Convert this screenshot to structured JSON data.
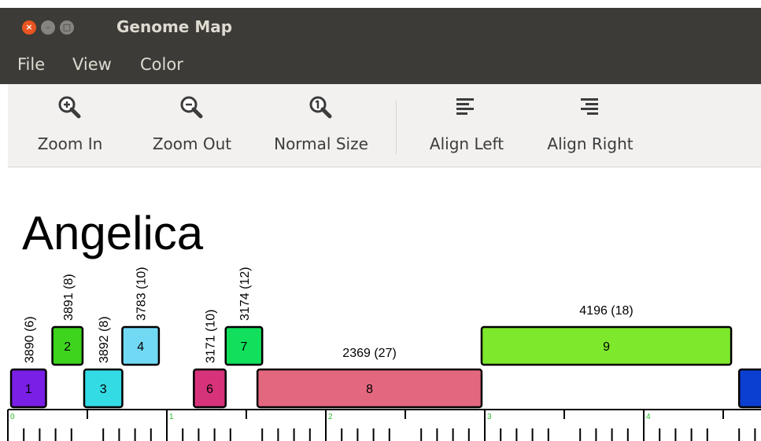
{
  "window": {
    "title": "Genome Map",
    "close_glyph": "×"
  },
  "menu": {
    "items": [
      "File",
      "View",
      "Color"
    ]
  },
  "toolbar": {
    "zoom_in": {
      "label": "Zoom In",
      "icon": "zoom-in-icon"
    },
    "zoom_out": {
      "label": "Zoom Out",
      "icon": "zoom-out-icon"
    },
    "normal_size": {
      "label": "Normal Size",
      "icon": "zoom-normal-icon"
    },
    "align_left": {
      "label": "Align Left",
      "icon": "align-left-icon"
    },
    "align_right": {
      "label": "Align Right",
      "icon": "align-right-icon"
    }
  },
  "map": {
    "organism": "Angelica",
    "ruler_labels": [
      "0",
      "1",
      "2",
      "3",
      "4"
    ],
    "genes": [
      {
        "id": "1",
        "label": "3890 (6)",
        "row": "lower",
        "start": 0.02,
        "end": 0.24,
        "color": "#7a1fe6",
        "label_orientation": "vertical"
      },
      {
        "id": "2",
        "label": "3891 (8)",
        "row": "upper",
        "start": 0.28,
        "end": 0.47,
        "color": "#3ed41e",
        "label_orientation": "vertical"
      },
      {
        "id": "3",
        "label": "3892 (8)",
        "row": "lower",
        "start": 0.48,
        "end": 0.72,
        "color": "#33dbe5",
        "label_orientation": "vertical"
      },
      {
        "id": "4",
        "label": "3783 (10)",
        "row": "upper",
        "start": 0.72,
        "end": 0.95,
        "color": "#72d9f5",
        "label_orientation": "vertical"
      },
      {
        "id": "6",
        "label": "3171 (10)",
        "row": "lower",
        "start": 1.17,
        "end": 1.37,
        "color": "#d6337a",
        "label_orientation": "vertical"
      },
      {
        "id": "7",
        "label": "3174 (12)",
        "row": "upper",
        "start": 1.37,
        "end": 1.6,
        "color": "#12e05c",
        "label_orientation": "vertical"
      },
      {
        "id": "8",
        "label": "2369 (27)",
        "row": "lower",
        "start": 1.57,
        "end": 2.98,
        "color": "#e3687f",
        "label_orientation": "horizontal"
      },
      {
        "id": "9",
        "label": "4196 (18)",
        "row": "upper",
        "start": 2.98,
        "end": 4.55,
        "color": "#7de82c",
        "label_orientation": "horizontal"
      },
      {
        "id": "",
        "label": "",
        "row": "lower",
        "start": 4.6,
        "end": 4.9,
        "color": "#0a3fd1",
        "label_orientation": "horizontal"
      }
    ]
  }
}
